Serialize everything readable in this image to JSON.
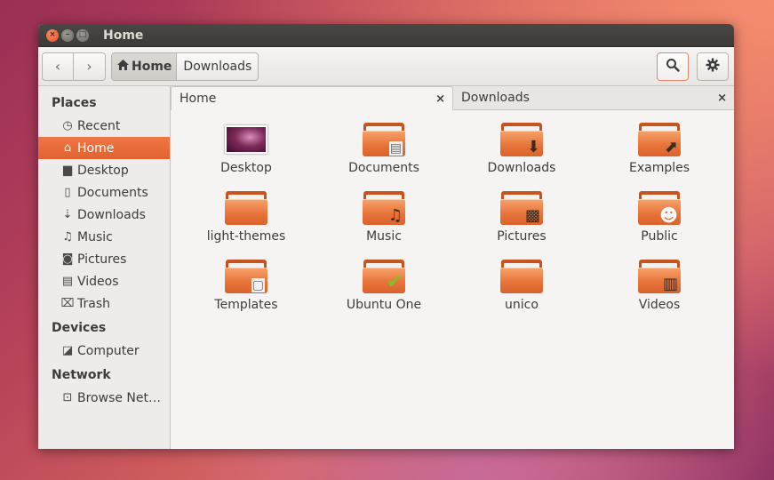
{
  "window": {
    "title": "Home"
  },
  "window_buttons": {
    "close": "×",
    "minimize": "–",
    "maximize": "□"
  },
  "toolbar": {
    "back_glyph": "‹",
    "forward_glyph": "›",
    "path": [
      {
        "label": "Home",
        "active": true,
        "icon": "home-icon"
      },
      {
        "label": "Downloads",
        "active": false
      }
    ]
  },
  "sidebar": {
    "sections": [
      {
        "title": "Places",
        "items": [
          {
            "label": "Recent",
            "icon": "clock-icon",
            "glyph": "◷"
          },
          {
            "label": "Home",
            "icon": "home-icon",
            "glyph": "⌂",
            "selected": true
          },
          {
            "label": "Desktop",
            "icon": "folder-icon",
            "glyph": "▆"
          },
          {
            "label": "Documents",
            "icon": "document-icon",
            "glyph": "▯"
          },
          {
            "label": "Downloads",
            "icon": "download-icon",
            "glyph": "⇣"
          },
          {
            "label": "Music",
            "icon": "music-icon",
            "glyph": "♫"
          },
          {
            "label": "Pictures",
            "icon": "camera-icon",
            "glyph": "◙"
          },
          {
            "label": "Videos",
            "icon": "film-icon",
            "glyph": "▤"
          },
          {
            "label": "Trash",
            "icon": "trash-icon",
            "glyph": "⌧"
          }
        ]
      },
      {
        "title": "Devices",
        "items": [
          {
            "label": "Computer",
            "icon": "drive-icon",
            "glyph": "◪"
          }
        ]
      },
      {
        "title": "Network",
        "items": [
          {
            "label": "Browse Net…",
            "icon": "network-icon",
            "glyph": "⊡"
          }
        ]
      }
    ]
  },
  "tabs": [
    {
      "label": "Home",
      "active": true,
      "close": "×"
    },
    {
      "label": "Downloads",
      "active": false,
      "close": "×"
    }
  ],
  "files": [
    {
      "name": "Desktop",
      "kind": "thumbnail"
    },
    {
      "name": "Documents",
      "kind": "folder",
      "emblem": "document-icon",
      "glyph": "▤"
    },
    {
      "name": "Downloads",
      "kind": "folder",
      "emblem": "download-icon",
      "glyph": "⬇"
    },
    {
      "name": "Examples",
      "kind": "folder",
      "emblem": "link-icon",
      "glyph": "⬈"
    },
    {
      "name": "light-themes",
      "kind": "folder"
    },
    {
      "name": "Music",
      "kind": "folder",
      "emblem": "music-icon",
      "glyph": "♫"
    },
    {
      "name": "Pictures",
      "kind": "folder",
      "emblem": "picture-icon",
      "glyph": "▩"
    },
    {
      "name": "Public",
      "kind": "folder",
      "emblem": "person-icon",
      "glyph": "☻"
    },
    {
      "name": "Templates",
      "kind": "folder",
      "emblem": "template-icon",
      "glyph": "▢"
    },
    {
      "name": "Ubuntu One",
      "kind": "folder",
      "emblem": "checkmark-icon",
      "glyph": "✔"
    },
    {
      "name": "unico",
      "kind": "folder"
    },
    {
      "name": "Videos",
      "kind": "folder",
      "emblem": "film-icon",
      "glyph": "▥"
    }
  ],
  "colors": {
    "accent": "#e1622f",
    "titlebar": "#3b3a37",
    "folder_orange": "#e8753b"
  }
}
